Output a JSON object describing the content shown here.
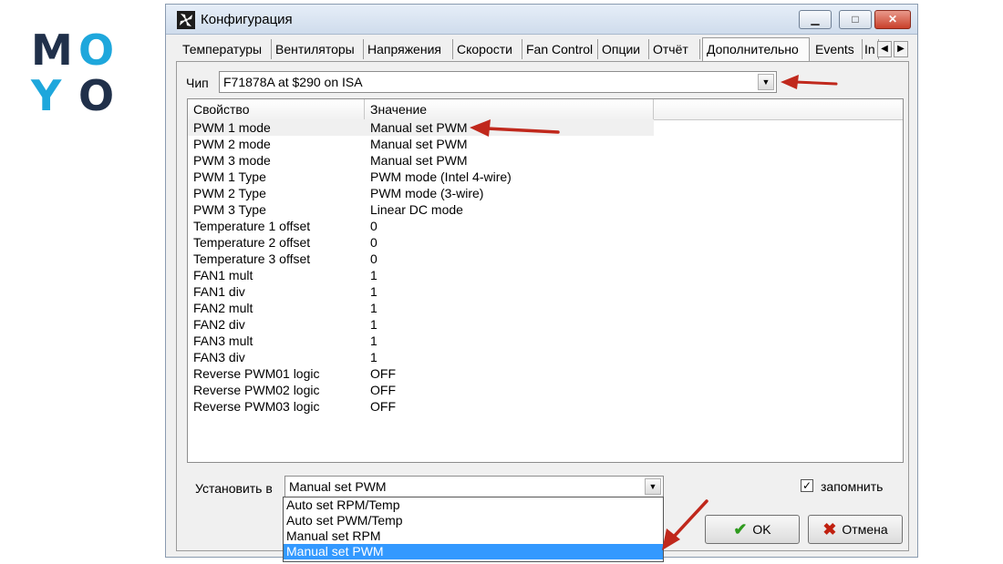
{
  "brand": {
    "logo": [
      "M",
      "O",
      "Y",
      "O"
    ]
  },
  "window": {
    "title": "Конфигурация",
    "controls": {
      "minimize": "▁",
      "maximize": "□",
      "close": "✕"
    }
  },
  "tabs": [
    "Температуры",
    "Вентиляторы",
    "Напряжения",
    "Скорости",
    "Fan Control",
    "Опции",
    "Отчёт",
    "Дополнительно",
    "Events",
    "In"
  ],
  "tabs_active": "Дополнительно",
  "chip": {
    "label": "Чип",
    "value": "F71878A at $290 on ISA"
  },
  "table": {
    "columns": [
      "Свойство",
      "Значение",
      ""
    ],
    "rows": [
      [
        "PWM 1 mode",
        "Manual set PWM"
      ],
      [
        "PWM 2 mode",
        "Manual set PWM"
      ],
      [
        "PWM 3 mode",
        "Manual set PWM"
      ],
      [
        "PWM 1 Type",
        "PWM mode (Intel 4-wire)"
      ],
      [
        "PWM 2 Type",
        "PWM mode (3-wire)"
      ],
      [
        "PWM 3 Type",
        "Linear DC mode"
      ],
      [
        "Temperature 1 offset",
        "0"
      ],
      [
        "Temperature 2 offset",
        "0"
      ],
      [
        "Temperature 3 offset",
        "0"
      ],
      [
        "FAN1 mult",
        "1"
      ],
      [
        "FAN1 div",
        "1"
      ],
      [
        "FAN2 mult",
        "1"
      ],
      [
        "FAN2 div",
        "1"
      ],
      [
        "FAN3 mult",
        "1"
      ],
      [
        "FAN3 div",
        "1"
      ],
      [
        "Reverse PWM01 logic",
        "OFF"
      ],
      [
        "Reverse PWM02 logic",
        "OFF"
      ],
      [
        "Reverse PWM03 logic",
        "OFF"
      ]
    ]
  },
  "set": {
    "label": "Установить в",
    "value": "Manual set PWM",
    "options": [
      "Auto set RPM/Temp",
      "Auto set PWM/Temp",
      "Manual set RPM",
      "Manual set PWM"
    ],
    "selected_option": "Manual set PWM"
  },
  "remember": {
    "label": "запомнить",
    "checked": true
  },
  "buttons": {
    "ok": "OK",
    "cancel": "Отмена"
  },
  "colors": {
    "annotation_arrow": "#c0281c",
    "selection": "#3399ff",
    "logo_dark": "#20304a",
    "logo_blue": "#1ea7dc"
  }
}
